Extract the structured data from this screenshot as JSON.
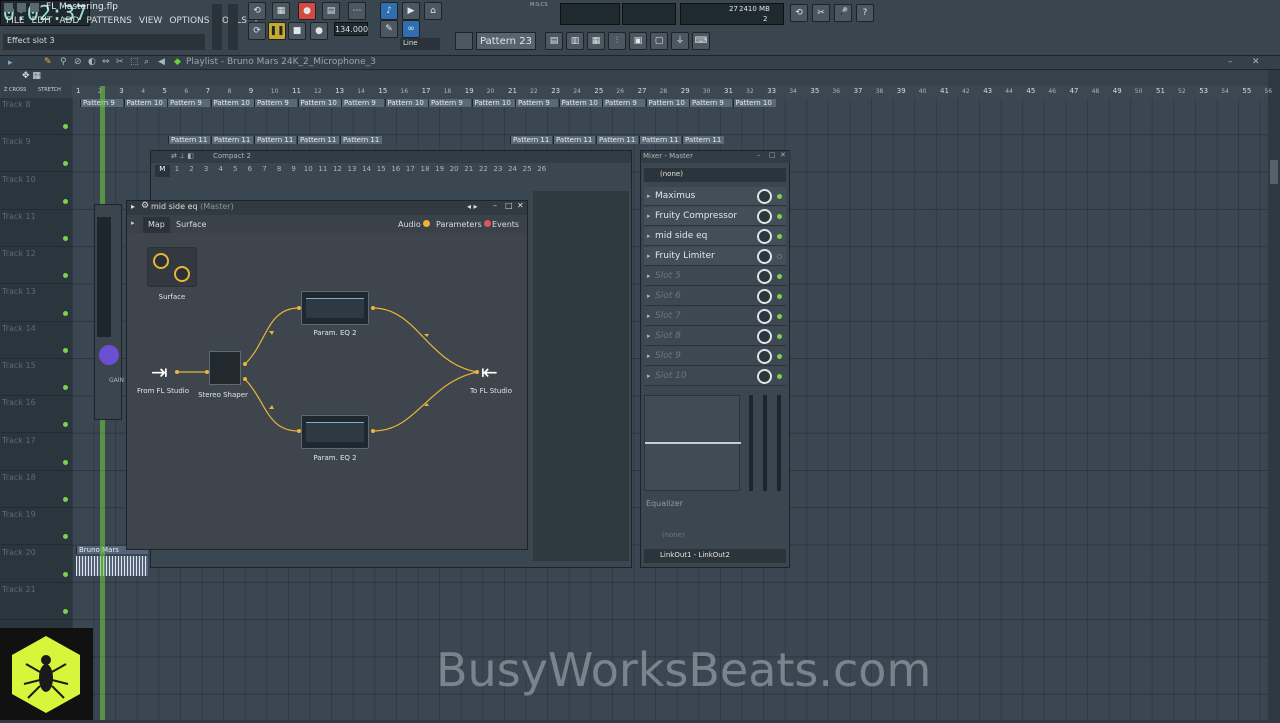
{
  "app": {
    "file_title": "FL Mastering.flp",
    "hint": "Effect slot 3",
    "menu": [
      "FILE",
      "EDIT",
      "ADD",
      "PATTERNS",
      "VIEW",
      "OPTIONS",
      "TOOLS",
      "?"
    ],
    "time": "0:02:37",
    "time_label": "M:S:CS",
    "tempo": "134.000",
    "pattern": "Pattern 23",
    "snap": "Line",
    "cpu": {
      "value": "27",
      "ram": "2410 MB",
      "voices": "2"
    }
  },
  "playlist": {
    "title": "Playlist - Bruno Mars 24K_2_Microphone_3",
    "snap_labels": [
      "Z CROSS",
      "STRETCH"
    ],
    "ruler": [
      "1",
      "3",
      "5",
      "7",
      "9",
      "11",
      "13",
      "15",
      "17",
      "19",
      "21",
      "23",
      "25",
      "27",
      "29",
      "31",
      "33",
      "35",
      "37",
      "39",
      "41",
      "43",
      "45",
      "47",
      "49",
      "51",
      "53",
      "55",
      "57"
    ],
    "ruler_minor": [
      "2",
      "4",
      "6",
      "8",
      "10",
      "12",
      "14",
      "16",
      "18",
      "20",
      "22",
      "24",
      "26",
      "28",
      "30",
      "32",
      "34",
      "36",
      "38",
      "40",
      "42",
      "44",
      "46",
      "48",
      "50",
      "52",
      "54",
      "56"
    ],
    "tracks": [
      "Track 8",
      "Track 9",
      "Track 10",
      "Track 11",
      "Track 12",
      "Track 13",
      "Track 14",
      "Track 15",
      "Track 16",
      "Track 17",
      "Track 18",
      "Track 19",
      "Track 20",
      "Track 21"
    ],
    "row8_clips": [
      "Pattern 9",
      "Pattern 10",
      "Pattern 9",
      "Pattern 10",
      "Pattern 9",
      "Pattern 10",
      "Pattern 9",
      "Pattern 10",
      "Pattern 9",
      "Pattern 10",
      "Pattern 9",
      "Pattern 10",
      "Pattern 9",
      "Pattern 10",
      "Pattern 9",
      "Pattern 10"
    ],
    "row9_clips": [
      "Pattern 11",
      "Pattern 11",
      "Pattern 11",
      "Pattern 11",
      "Pattern 11",
      "Pattern 11",
      "Pattern 11",
      "Pattern 11",
      "Pattern 11",
      "Pattern 11"
    ],
    "audio_clip": "Bruno Mars"
  },
  "compact": {
    "title": "Compact 2",
    "channels": [
      "M",
      "1",
      "2",
      "3",
      "4",
      "5",
      "6",
      "7",
      "8",
      "9",
      "10",
      "11",
      "12",
      "13",
      "14",
      "15",
      "16",
      "17",
      "18",
      "19",
      "20",
      "21",
      "22",
      "23",
      "24",
      "25",
      "26"
    ]
  },
  "patcher": {
    "title": "mid side eq",
    "title_suffix": "(Master)",
    "tabs": [
      "Map",
      "Surface"
    ],
    "legend": [
      "Audio",
      "Parameters",
      "Events"
    ],
    "legend_colors": [
      "#f2b233",
      "#e0545a",
      "#4fd39a"
    ],
    "nodes": {
      "surface": "Surface",
      "from": "From FL Studio",
      "shaper": "Stereo Shaper",
      "eq_top": "Param. EQ 2",
      "eq_bottom": "Param. EQ 2",
      "to": "To FL Studio"
    },
    "side_knob_label": "GAIN"
  },
  "mixer": {
    "title": "Mixer - Master",
    "input": "(none)",
    "slots": [
      {
        "label": "Maximus",
        "empty": false,
        "led": true
      },
      {
        "label": "Fruity Compressor",
        "empty": false,
        "led": true
      },
      {
        "label": "mid side eq",
        "empty": false,
        "led": true
      },
      {
        "label": "Fruity Limiter",
        "empty": false,
        "led": false
      },
      {
        "label": "Slot 5",
        "empty": true,
        "led": true
      },
      {
        "label": "Slot 6",
        "empty": true,
        "led": true
      },
      {
        "label": "Slot 7",
        "empty": true,
        "led": true
      },
      {
        "label": "Slot 8",
        "empty": true,
        "led": true
      },
      {
        "label": "Slot 9",
        "empty": true,
        "led": true
      },
      {
        "label": "Slot 10",
        "empty": true,
        "led": true
      }
    ],
    "eq_label": "Equalizer",
    "output_none": "(none)",
    "output": "LinkOut1 - LinkOut2"
  },
  "watermark": "BusyWorksBeats.com",
  "colors": {
    "accent_green": "#7fd04a",
    "wire": "#e8b43a",
    "grid": "#3a4752"
  }
}
